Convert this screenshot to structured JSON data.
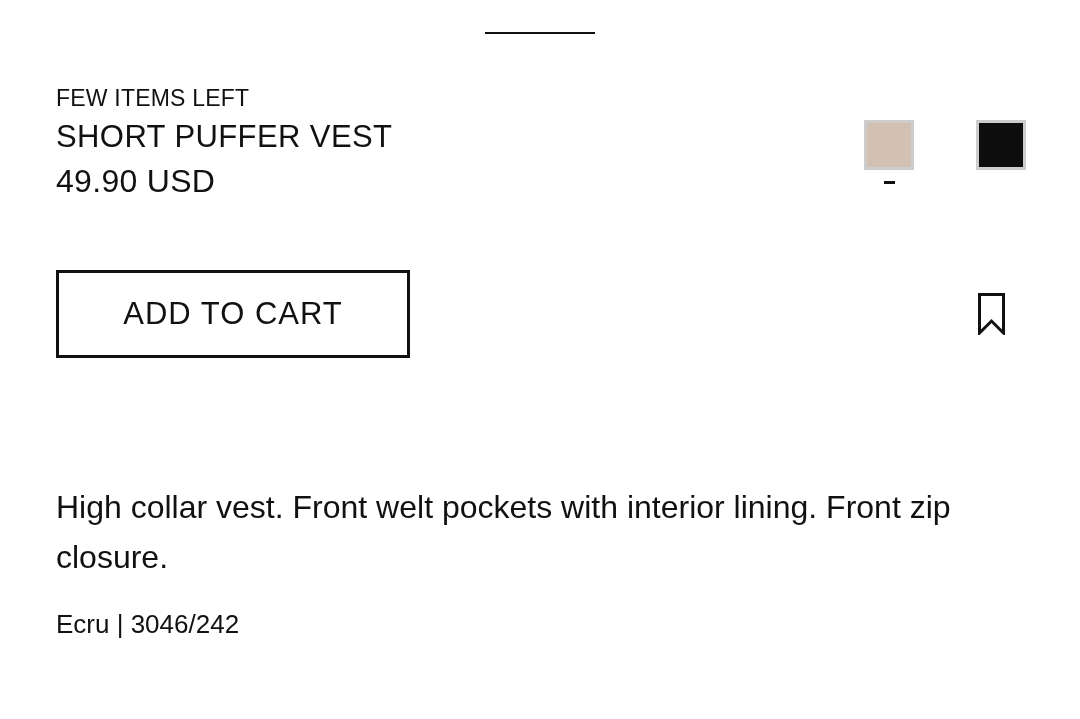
{
  "product": {
    "stock_notice": "FEW ITEMS LEFT",
    "name": "SHORT PUFFER VEST",
    "price": "49.90 USD"
  },
  "colors": [
    {
      "color": "#d2c1b3",
      "selected": true
    },
    {
      "color": "#0d0d0d",
      "selected": false
    }
  ],
  "add_to_cart": {
    "label": "ADD TO CART"
  },
  "description": "High collar vest. Front welt pockets with interior lining. Front zip closure.",
  "color_reference": "Ecru | 3046/242"
}
